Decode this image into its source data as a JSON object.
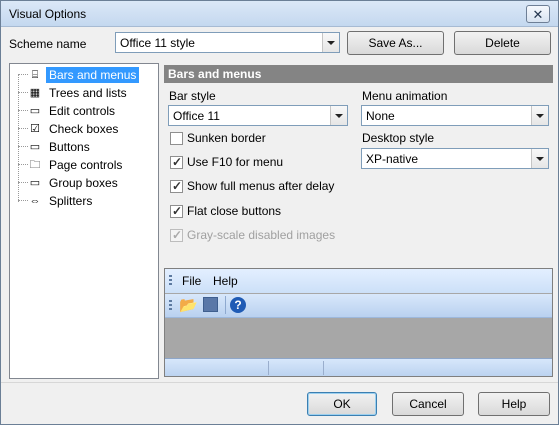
{
  "window": {
    "title": "Visual Options"
  },
  "scheme": {
    "label": "Scheme name",
    "value": "Office 11 style",
    "save_as": "Save As...",
    "delete": "Delete"
  },
  "tree": {
    "items": [
      {
        "label": "Bars and menus",
        "icon": "bars-menus-icon",
        "selected": true
      },
      {
        "label": "Trees and lists",
        "icon": "tree-list-icon"
      },
      {
        "label": "Edit controls",
        "icon": "edit-control-icon"
      },
      {
        "label": "Check boxes",
        "icon": "checkbox-icon"
      },
      {
        "label": "Buttons",
        "icon": "button-icon"
      },
      {
        "label": "Page controls",
        "icon": "folder-icon"
      },
      {
        "label": "Group boxes",
        "icon": "group-box-icon"
      },
      {
        "label": "Splitters",
        "icon": "splitter-icon"
      }
    ]
  },
  "section": {
    "title": "Bars and menus"
  },
  "fields": {
    "bar_style": {
      "label": "Bar style",
      "value": "Office 11"
    },
    "menu_animation": {
      "label": "Menu animation",
      "value": "None"
    },
    "desktop_style": {
      "label": "Desktop style",
      "value": "XP-native"
    }
  },
  "checks": [
    {
      "label": "Sunken border",
      "checked": false
    },
    {
      "label": "Use F10 for menu",
      "checked": true
    },
    {
      "label": "Show full menus after delay",
      "checked": true
    },
    {
      "label": "Flat close buttons",
      "checked": true
    },
    {
      "label": "Gray-scale disabled images",
      "checked": true,
      "disabled": true
    }
  ],
  "preview": {
    "menu_file": "File",
    "menu_help": "Help"
  },
  "buttons": {
    "ok": "OK",
    "cancel": "Cancel",
    "help": "Help"
  }
}
